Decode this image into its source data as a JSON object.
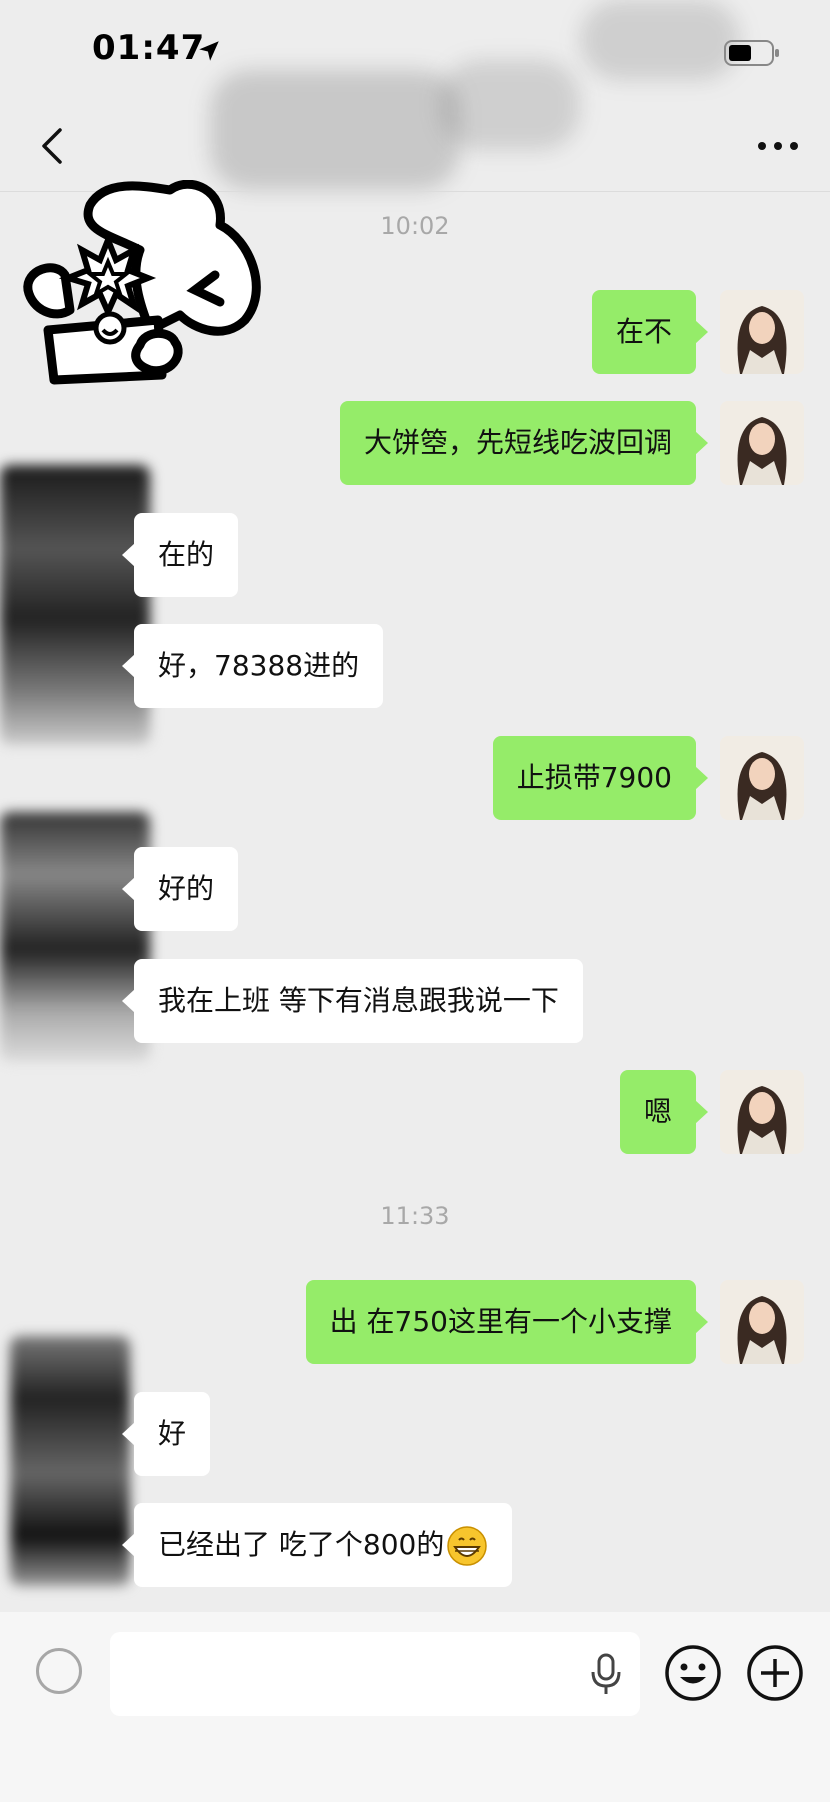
{
  "status_bar": {
    "time": "01:47"
  },
  "chat": {
    "timestamps": [
      "10:02",
      "11:33"
    ],
    "messages": [
      {
        "side": "right",
        "text": "在不"
      },
      {
        "side": "right",
        "text": "大饼箜，先短线吃波回调"
      },
      {
        "side": "left",
        "text": "在的"
      },
      {
        "side": "left",
        "text": "好，78388进的"
      },
      {
        "side": "right",
        "text": "止损带7900"
      },
      {
        "side": "left",
        "text": "好的"
      },
      {
        "side": "left",
        "text": "我在上班 等下有消息跟我说一下"
      },
      {
        "side": "right",
        "text": "嗯"
      },
      {
        "side": "right",
        "text": "出 在750这里有一个小支撑"
      },
      {
        "side": "left",
        "text": "好"
      },
      {
        "side": "left",
        "text": "已经出了 吃了个800的"
      }
    ]
  },
  "input_bar": {
    "placeholder": ""
  },
  "colors": {
    "sent_bubble": "#95ec69",
    "received_bubble": "#ffffff",
    "background": "#ededed"
  },
  "icons": [
    "location-arrow-icon",
    "battery-icon",
    "back-chevron-icon",
    "more-dots-icon",
    "mic-icon",
    "emoji-icon",
    "plus-icon",
    "grin-emoji-icon"
  ]
}
